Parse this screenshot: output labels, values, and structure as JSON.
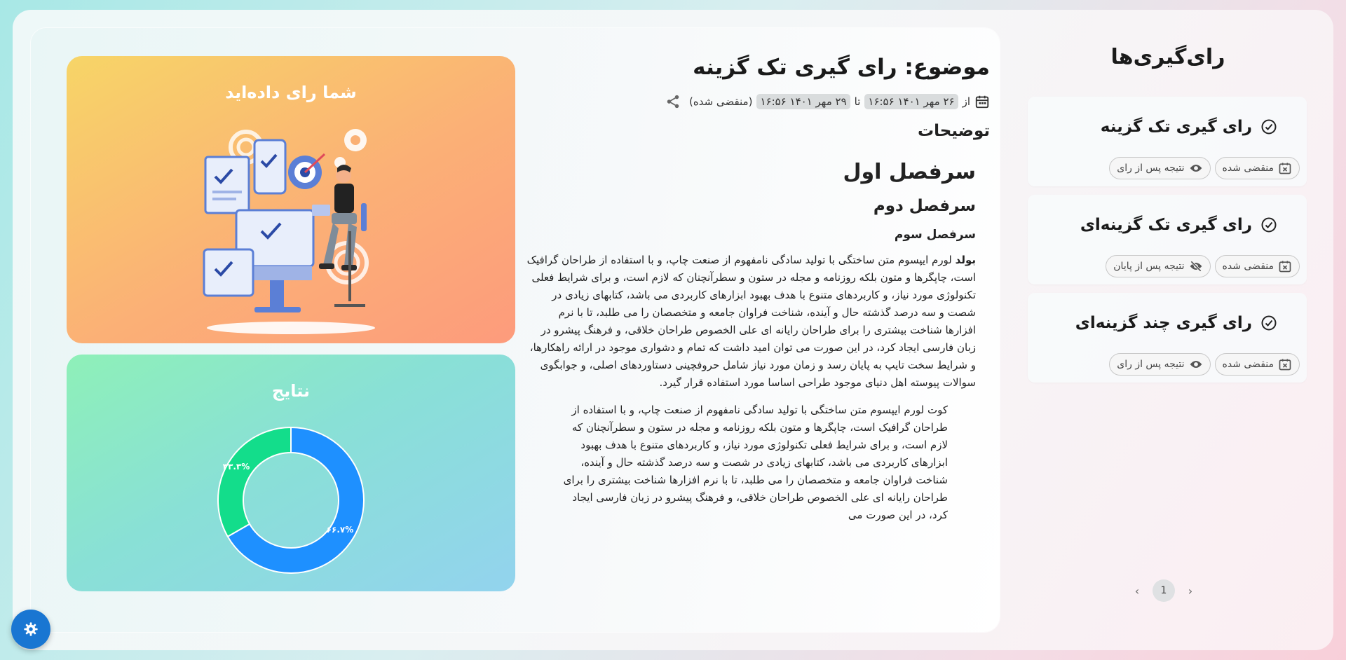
{
  "vote_card": {
    "title": "شما رای داده‌اید"
  },
  "results_card": {
    "title": "نتایج",
    "label_a": "۶۶.۷%",
    "label_b": "۳۳.۳%"
  },
  "chart_data": {
    "type": "pie",
    "categories": [
      "",
      ""
    ],
    "values": [
      66.7,
      33.3
    ],
    "colors": [
      "#1e90ff",
      "#13dd8b"
    ],
    "labels": [
      "۶۶.۷%",
      "۳۳.۳%"
    ]
  },
  "topic": {
    "title": "موضوع: رای گیری تک گزینه",
    "from_label": "از",
    "start": "۲۶ مهر ۱۴۰۱ ۱۶:۵۶",
    "to_label": "تا",
    "end": "۲۹ مهر ۱۴۰۱ ۱۶:۵۶",
    "status": "(منقضی شده)",
    "description_label": "توضیحات"
  },
  "article": {
    "h1": "سرفصل اول",
    "h2": "سرفصل دوم",
    "h3": "سرفصل سوم",
    "bold": "بولد",
    "para": " لورم ایپسوم متن ساختگی با تولید سادگی نامفهوم از صنعت چاپ، و با استفاده از طراحان گرافیک است، چاپگرها و متون بلکه روزنامه و مجله در ستون و سطرآنچنان که لازم است، و برای شرایط فعلی تکنولوژی مورد نیاز، و کاربردهای متنوع با هدف بهبود ابزارهای کاربردی می باشد، کتابهای زیادی در شصت و سه درصد گذشته حال و آینده، شناخت فراوان جامعه و متخصصان را می طلبد، تا با نرم افزارها شناخت بیشتری را برای طراحان رایانه ای علی الخصوص طراحان خلاقی، و فرهنگ پیشرو در زبان فارسی ایجاد کرد، در این صورت می توان امید داشت که تمام و دشواری موجود در ارائه راهکارها، و شرایط سخت تایپ به پایان رسد و زمان مورد نیاز شامل حروفچینی دستاوردهای اصلی، و جوابگوی سوالات پیوسته اهل دنیای موجود طراحی اساسا مورد استفاده قرار گیرد.",
    "quote": "کوت لورم ایپسوم متن ساختگی با تولید سادگی نامفهوم از صنعت چاپ، و با استفاده از طراحان گرافیک است، چاپگرها و متون بلکه روزنامه و مجله در ستون و سطرآنچنان که لازم است، و برای شرایط فعلی تکنولوژی مورد نیاز، و کاربردهای متنوع با هدف بهبود ابزارهای کاربردی می باشد، کتابهای زیادی در شصت و سه درصد گذشته حال و آینده، شناخت فراوان جامعه و متخصصان را می طلبد، تا با نرم افزارها شناخت بیشتری را برای طراحان رایانه ای علی الخصوص طراحان خلاقی، و فرهنگ پیشرو در زبان فارسی ایجاد کرد، در این صورت می"
  },
  "sidebar": {
    "title": "رای‌گیری‌ها",
    "polls": [
      {
        "title": "رای گیری تک گزینه",
        "status": "منقضی شده",
        "result": "نتیجه پس از رای",
        "result_icon": "eye-icon"
      },
      {
        "title": "رای گیری تک گزینه‌ای",
        "status": "منقضی شده",
        "result": "نتیجه پس از پایان",
        "result_icon": "eye-off-icon"
      },
      {
        "title": "رای گیری چند گزینه‌ای",
        "status": "منقضی شده",
        "result": "نتیجه پس از رای",
        "result_icon": "eye-icon"
      }
    ]
  },
  "pagination": {
    "current": "1",
    "prev": "‹",
    "next": "›"
  }
}
